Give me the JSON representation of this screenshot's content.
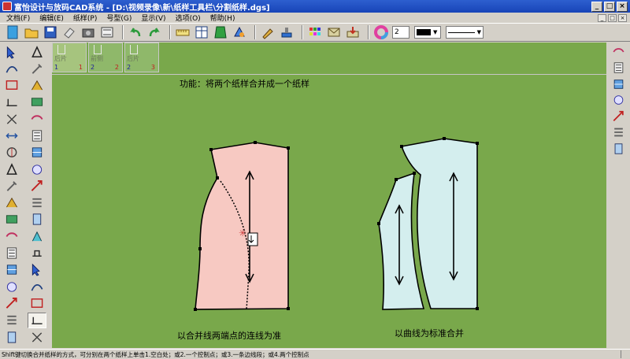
{
  "window": {
    "title": "富怡设计与放码CAD系统 - [D:\\视频录像\\新\\纸样工具栏\\分割纸样.dgs]",
    "minimize": "_",
    "maximize": "□",
    "close": "×"
  },
  "menu": [
    "文档(F)",
    "编辑(E)",
    "纸样(P)",
    "号型(G)",
    "显示(V)",
    "选项(O)",
    "帮助(H)"
  ],
  "mdi_controls": [
    "_",
    "□",
    "×"
  ],
  "toolbar": {
    "line_width_value": "2",
    "color_swatch": "#000000",
    "line_style": "solid"
  },
  "pieces": [
    {
      "label": "后片",
      "idx": "1",
      "num": "1"
    },
    {
      "label": "前侧",
      "idx": "2",
      "num": "2"
    },
    {
      "label": "后片",
      "idx": "2",
      "num": "3"
    }
  ],
  "canvas": {
    "function_text": "功能：将两个纸样合并成一个纸样",
    "caption_left": "以合并线两端点的连线为准",
    "caption_right": "以曲线为标准合并",
    "background": "#79a84b",
    "pattern_left_fill": "#f7c9c2",
    "pattern_right_fill": "#d4eeee"
  },
  "status": {
    "text": "Shift键切换合并纸样的方式，可分别在两个纸样上单击1.空白处；或2.一个控制点；或3.一条边线段；或4.两个控制点"
  }
}
